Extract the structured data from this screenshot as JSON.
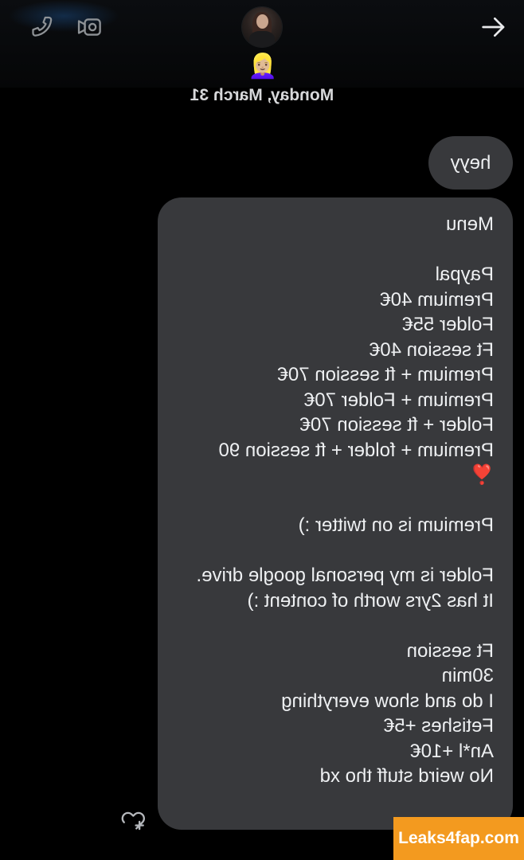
{
  "header": {
    "call_icon": "phone-icon",
    "video_icon": "video-camera-icon",
    "forward_icon": "arrow-right-icon",
    "avatar": "contact-avatar",
    "status_emoji": "👱🏼‍♀️",
    "date": "Monday, March 31"
  },
  "messages": [
    {
      "id": "heyy",
      "text": "heyy"
    },
    {
      "id": "menu",
      "lines": [
        "Menu",
        "",
        "Paypal",
        "Premium 40€",
        "Folder 55€",
        "Ft session 40€",
        "Premium + ft session 70€",
        "Premium + Folder 70€",
        "Folder + ft session 70€",
        "Premium + folder + ft session 90",
        "❣️",
        "",
        "Premium is on twitter :)",
        "",
        "Folder is my personal google drive. It has 2yrs worth of content :)",
        "",
        "Ft session",
        "30min",
        "I do and show everything",
        "Fetishes +5€",
        "An*l +10€",
        "No weird stuff tho xd"
      ]
    }
  ],
  "reaction_icon": "add-reaction-heart-icon",
  "watermark": "Leaks4fap.com",
  "colors": {
    "background": "#000000",
    "bubble": "#38393c",
    "text": "#eef0f2",
    "watermark": "#f39a1f",
    "heart": "#e0304a"
  }
}
